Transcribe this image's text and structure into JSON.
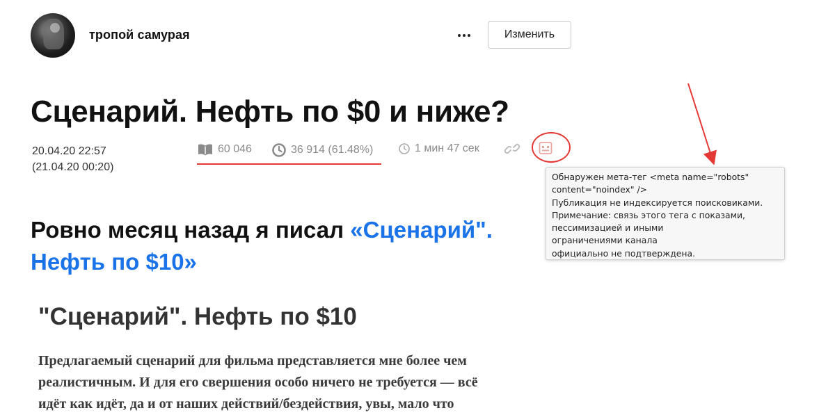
{
  "channel": {
    "name": "тропой самурая"
  },
  "header": {
    "edit_label": "Изменить"
  },
  "article": {
    "title": "Сценарий. Нефть по $0 и ниже?",
    "date": "20.04.20 22:57",
    "date_edited": "(21.04.20 00:20)",
    "views": "60 046",
    "reads": "36 914 (61.48%)",
    "read_time": "1 мин 47 сек"
  },
  "tooltip": {
    "lines": [
      "Обнаружен мета-тег <meta name=\"robots\"",
      "content=\"noindex\" />",
      "Публикация не индексируется поисковиками.",
      "Примечание: связь этого тега с показами,",
      "пессимизацией и иными",
      "ограничениями канала",
      "официально не подтверждена."
    ]
  },
  "content": {
    "subheading_prefix": "Ровно месяц назад я писал ",
    "subheading_link": "«Сценарий\". Нефть по $10»",
    "quote_title": "\"Сценарий\". Нефть по $10",
    "quote_lines": [
      "Предлагаемый сценарий для фильма представляется мне более чем",
      "реалистичным. И для его свершения особо ничего не требуется — всё",
      "идёт как идёт, да и от наших действий/бездействия, увы, мало что"
    ]
  },
  "colors": {
    "accent_link": "#1a73e8",
    "annotation_red": "#e53935",
    "stat_gray": "#8a8a8a"
  },
  "icons": [
    "book-icon",
    "clock-icon",
    "small-clock-icon",
    "link-icon",
    "meta-tag-icon",
    "more-icon"
  ]
}
